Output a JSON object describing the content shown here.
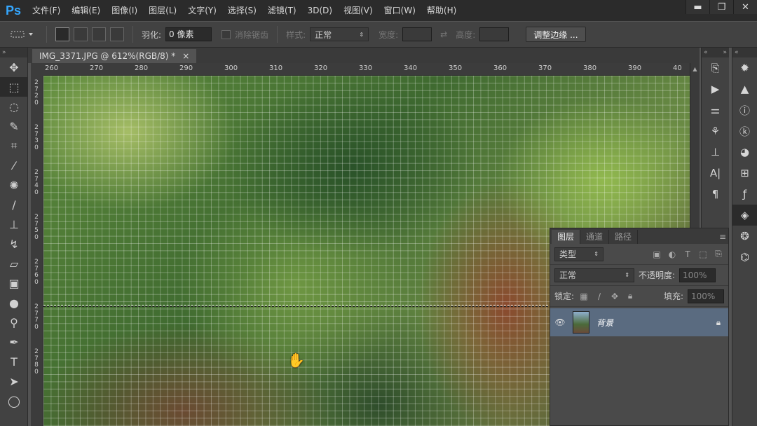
{
  "app": {
    "logo": "Ps"
  },
  "menu": [
    "文件(F)",
    "编辑(E)",
    "图像(I)",
    "图层(L)",
    "文字(Y)",
    "选择(S)",
    "滤镜(T)",
    "3D(D)",
    "视图(V)",
    "窗口(W)",
    "帮助(H)"
  ],
  "window_controls": {
    "minimize": "▬",
    "restore": "❐",
    "close": "✕"
  },
  "options": {
    "feather_label": "羽化:",
    "feather_value": "0 像素",
    "antialias_label": "消除锯齿",
    "style_label": "样式:",
    "style_value": "正常",
    "width_label": "宽度:",
    "height_label": "高度:",
    "refine_button": "调整边缘 ..."
  },
  "document": {
    "tab_title": "IMG_3371.JPG @ 612%(RGB/8) *",
    "close": "×"
  },
  "ruler": {
    "h_ticks": [
      "260",
      "270",
      "280",
      "290",
      "300",
      "310",
      "320",
      "330",
      "340",
      "350",
      "360",
      "370",
      "380",
      "390",
      "40"
    ],
    "v_ticks": [
      "2\n7\n2\n0",
      "2\n7\n3\n0",
      "2\n7\n4\n0",
      "2\n7\n5\n0",
      "2\n7\n6\n0",
      "2\n7\n7\n0",
      "2\n7\n8\n0"
    ]
  },
  "layers_panel": {
    "tabs": [
      "图层",
      "通道",
      "路径"
    ],
    "filter_kind": "类型",
    "blend_mode": "正常",
    "opacity_label": "不透明度:",
    "opacity_value": "100%",
    "lock_label": "锁定:",
    "fill_label": "填充:",
    "fill_value": "100%",
    "layer_name": "背景"
  },
  "colors": {
    "accent": "#35a7ff",
    "layer_selected": "#5a6b80"
  }
}
